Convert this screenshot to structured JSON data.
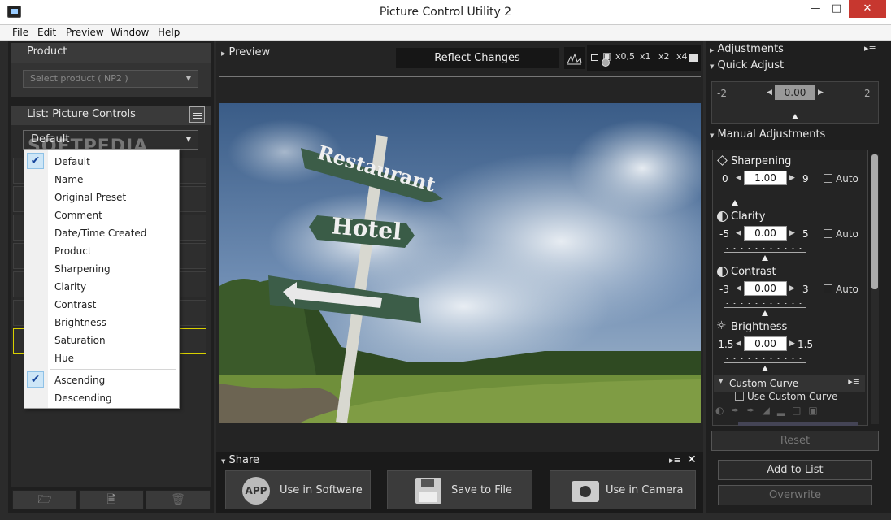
{
  "window": {
    "title": "Picture Control Utility 2"
  },
  "menu": [
    "File",
    "Edit",
    "Preview",
    "Window",
    "Help"
  ],
  "left": {
    "product_header": "Product",
    "product_select": "Select product ( NP2 )",
    "list_header": "List: Picture Controls",
    "list_dropdown": "Default",
    "sort_menu": {
      "items": [
        "Default",
        "Name",
        "Original Preset",
        "Comment",
        "Date/Time Created",
        "Product",
        "Sharpening",
        "Clarity",
        "Contrast",
        "Brightness",
        "Saturation",
        "Hue"
      ],
      "order_items": [
        "Ascending",
        "Descending"
      ],
      "checked_item": "Default",
      "checked_order": "Ascending"
    },
    "watermark": "SOFTPEDIA"
  },
  "preview": {
    "header": "Preview",
    "reflect_button": "Reflect Changes",
    "zoom_levels": [
      "x0,5",
      "x1",
      "x2",
      "x4"
    ],
    "sign_texts": [
      "Restaurant",
      "Hotel"
    ]
  },
  "share": {
    "header": "Share",
    "buttons": [
      "Use in Software",
      "Save to File",
      "Use in Camera"
    ],
    "app_icon_text": "APP"
  },
  "adjustments": {
    "header": "Adjustments",
    "quick_adjust": {
      "label": "Quick Adjust",
      "min": "-2",
      "max": "2",
      "value": "0.00"
    },
    "manual_header": "Manual Adjustments",
    "sharpening": {
      "label": "Sharpening",
      "min": "0",
      "max": "9",
      "value": "1.00",
      "auto": "Auto"
    },
    "clarity": {
      "label": "Clarity",
      "min": "-5",
      "max": "5",
      "value": "0.00",
      "auto": "Auto"
    },
    "contrast": {
      "label": "Contrast",
      "min": "-3",
      "max": "3",
      "value": "0.00",
      "auto": "Auto"
    },
    "brightness": {
      "label": "Brightness",
      "min": "-1.5",
      "max": "1.5",
      "value": "0.00"
    },
    "custom_curve": {
      "label": "Custom Curve",
      "checkbox": "Use Custom Curve"
    },
    "reset": "Reset",
    "add_to_list": "Add to List",
    "overwrite": "Overwrite"
  }
}
